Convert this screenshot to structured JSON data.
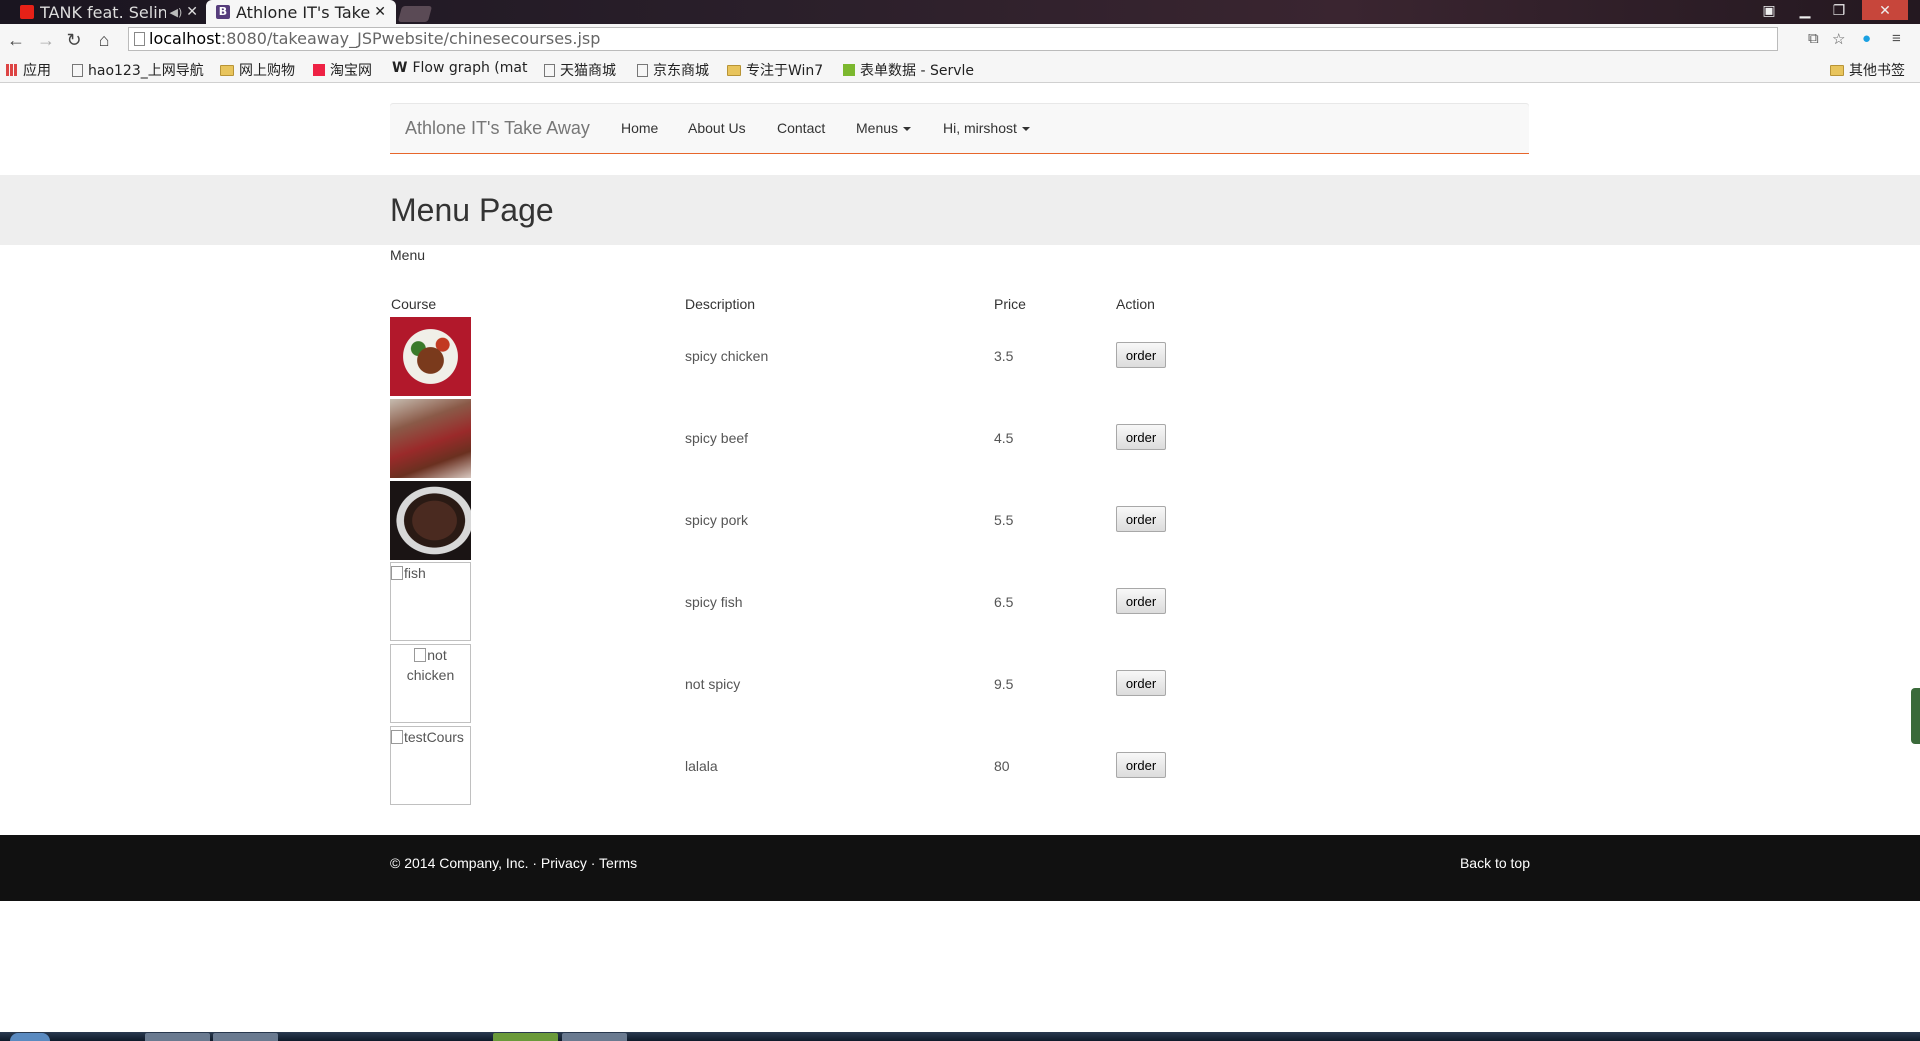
{
  "browser": {
    "tabs": [
      {
        "title": "TANK feat. Selin",
        "active": false,
        "icon": "youtube-icon"
      },
      {
        "title": "Athlone IT's Take A",
        "active": true,
        "icon": "bootstrap-icon"
      }
    ],
    "url_host": "localhost",
    "url_path": ":8080/takeaway_JSPwebsite/chinesecourses.jsp",
    "bookmarks": [
      {
        "label": "应用",
        "icon": "apps-icon"
      },
      {
        "label": "hao123_上网导航",
        "icon": "page-icon"
      },
      {
        "label": "网上购物",
        "icon": "folder-icon"
      },
      {
        "label": "淘宝网",
        "icon": "taobao-icon"
      },
      {
        "label": "Flow graph (mat",
        "icon": "wikipedia-icon"
      },
      {
        "label": "天猫商城",
        "icon": "page-icon"
      },
      {
        "label": "京东商城",
        "icon": "page-icon"
      },
      {
        "label": "专注于Win7",
        "icon": "folder-icon"
      },
      {
        "label": "表单数据 - Servle",
        "icon": "green-icon"
      }
    ],
    "other_bookmarks": "其他书签"
  },
  "navbar": {
    "brand": "Athlone IT's Take Away",
    "links": [
      "Home",
      "About Us",
      "Contact"
    ],
    "menus_dropdown": "Menus",
    "user_dropdown": "Hi, mirshost"
  },
  "page": {
    "title": "Menu Page",
    "subtitle": "Menu"
  },
  "table": {
    "headers": [
      "Course",
      "Description",
      "Price",
      "Action"
    ],
    "rows": [
      {
        "image_alt": "",
        "image": "food-chicken",
        "description": "spicy chicken",
        "price": "3.5",
        "action": "order"
      },
      {
        "image_alt": "",
        "image": "food-beef",
        "description": "spicy beef",
        "price": "4.5",
        "action": "order"
      },
      {
        "image_alt": "",
        "image": "food-pork",
        "description": "spicy pork",
        "price": "5.5",
        "action": "order"
      },
      {
        "image_alt": "fish",
        "image": "broken",
        "description": "spicy fish",
        "price": "6.5",
        "action": "order"
      },
      {
        "image_alt": "not chicken",
        "image": "broken",
        "description": "not spicy",
        "price": "9.5",
        "action": "order"
      },
      {
        "image_alt": "testCours",
        "image": "broken",
        "description": "lalala",
        "price": "80",
        "action": "order"
      }
    ]
  },
  "footer": {
    "copyright": "© 2014 Company, Inc.",
    "sep": "·",
    "privacy": "Privacy",
    "terms": "Terms",
    "back_to_top": "Back to top"
  },
  "colors": {
    "navbar_accent": "#e7662b",
    "footer_bg": "#111111",
    "jumbotron_bg": "#eeeeee"
  }
}
